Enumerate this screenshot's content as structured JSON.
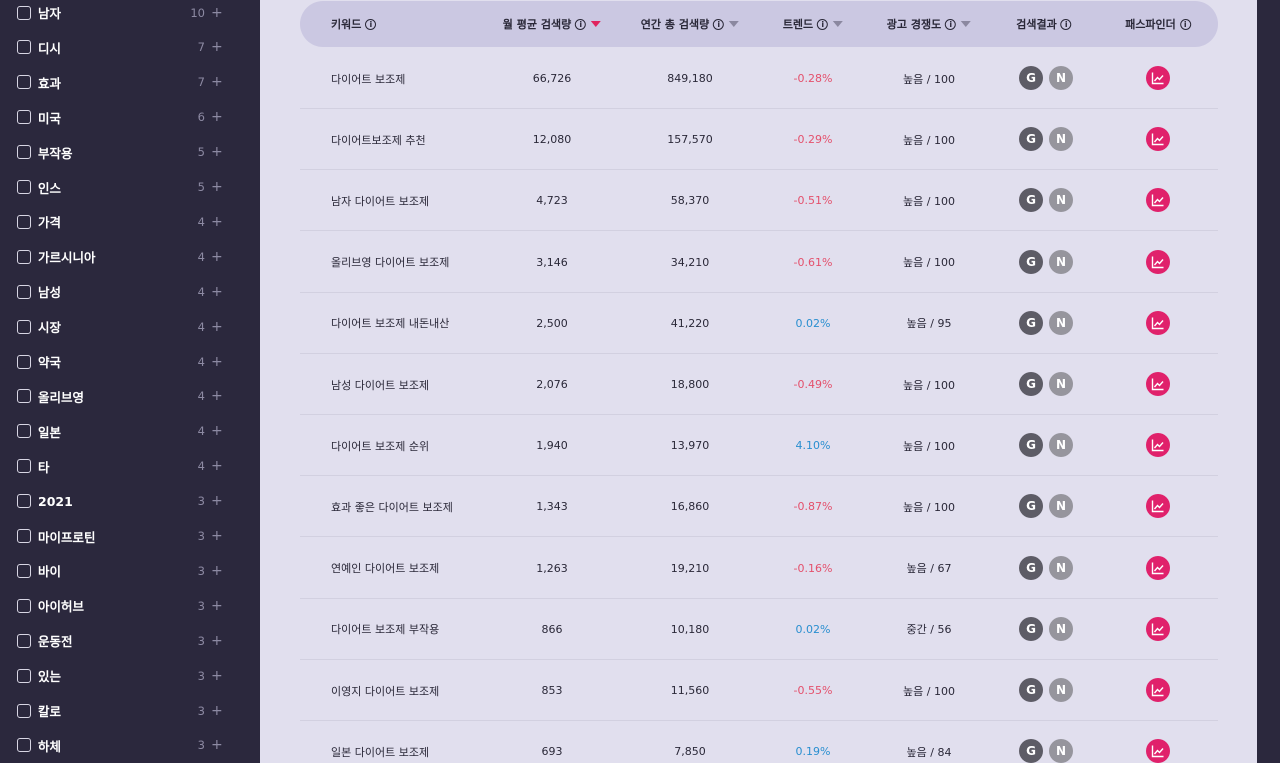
{
  "sidebar": {
    "items": [
      {
        "label": "남자",
        "count": "10"
      },
      {
        "label": "디시",
        "count": "7"
      },
      {
        "label": "효과",
        "count": "7"
      },
      {
        "label": "미국",
        "count": "6"
      },
      {
        "label": "부작용",
        "count": "5"
      },
      {
        "label": "인스",
        "count": "5"
      },
      {
        "label": "가격",
        "count": "4"
      },
      {
        "label": "가르시니아",
        "count": "4"
      },
      {
        "label": "남성",
        "count": "4"
      },
      {
        "label": "시장",
        "count": "4"
      },
      {
        "label": "약국",
        "count": "4"
      },
      {
        "label": "올리브영",
        "count": "4"
      },
      {
        "label": "일본",
        "count": "4"
      },
      {
        "label": "타",
        "count": "4"
      },
      {
        "label": "2021",
        "count": "3"
      },
      {
        "label": "마이프로틴",
        "count": "3"
      },
      {
        "label": "바이",
        "count": "3"
      },
      {
        "label": "아이허브",
        "count": "3"
      },
      {
        "label": "운동전",
        "count": "3"
      },
      {
        "label": "있는",
        "count": "3"
      },
      {
        "label": "칼로",
        "count": "3"
      },
      {
        "label": "하체",
        "count": "3"
      }
    ],
    "plus_symbol": "+"
  },
  "table": {
    "headers": {
      "keyword": "키워드",
      "monthly": "월 평균 검색량",
      "yearly": "연간 총 검색량",
      "trend": "트렌드",
      "competition": "광고 경쟁도",
      "results": "검색결과",
      "pathfinder": "패스파인더"
    },
    "info_symbol": "i",
    "google_label": "G",
    "naver_label": "N",
    "rows": [
      {
        "keyword": "다이어트 보조제",
        "monthly": "66,726",
        "yearly": "849,180",
        "trend": "-0.28%",
        "trend_dir": "neg",
        "competition": "높음 / 100"
      },
      {
        "keyword": "다이어트보조제 추천",
        "monthly": "12,080",
        "yearly": "157,570",
        "trend": "-0.29%",
        "trend_dir": "neg",
        "competition": "높음 / 100"
      },
      {
        "keyword": "남자 다이어트 보조제",
        "monthly": "4,723",
        "yearly": "58,370",
        "trend": "-0.51%",
        "trend_dir": "neg",
        "competition": "높음 / 100"
      },
      {
        "keyword": "올리브영 다이어트 보조제",
        "monthly": "3,146",
        "yearly": "34,210",
        "trend": "-0.61%",
        "trend_dir": "neg",
        "competition": "높음 / 100"
      },
      {
        "keyword": "다이어트 보조제 내돈내산",
        "monthly": "2,500",
        "yearly": "41,220",
        "trend": "0.02%",
        "trend_dir": "pos",
        "competition": "높음 / 95"
      },
      {
        "keyword": "남성 다이어트 보조제",
        "monthly": "2,076",
        "yearly": "18,800",
        "trend": "-0.49%",
        "trend_dir": "neg",
        "competition": "높음 / 100"
      },
      {
        "keyword": "다이어트 보조제 순위",
        "monthly": "1,940",
        "yearly": "13,970",
        "trend": "4.10%",
        "trend_dir": "pos",
        "competition": "높음 / 100"
      },
      {
        "keyword": "효과 좋은 다이어트 보조제",
        "monthly": "1,343",
        "yearly": "16,860",
        "trend": "-0.87%",
        "trend_dir": "neg",
        "competition": "높음 / 100"
      },
      {
        "keyword": "연예인 다이어트 보조제",
        "monthly": "1,263",
        "yearly": "19,210",
        "trend": "-0.16%",
        "trend_dir": "neg",
        "competition": "높음 / 67"
      },
      {
        "keyword": "다이어트 보조제 부작용",
        "monthly": "866",
        "yearly": "10,180",
        "trend": "0.02%",
        "trend_dir": "pos",
        "competition": "중간 / 56"
      },
      {
        "keyword": "이영지 다이어트 보조제",
        "monthly": "853",
        "yearly": "11,560",
        "trend": "-0.55%",
        "trend_dir": "neg",
        "competition": "높음 / 100"
      },
      {
        "keyword": "일본 다이어트 보조제",
        "monthly": "693",
        "yearly": "7,850",
        "trend": "0.19%",
        "trend_dir": "pos",
        "competition": "높음 / 84"
      }
    ]
  },
  "colors": {
    "sidebar_bg": "#2b283d",
    "main_bg": "#e1dfee",
    "header_bg": "#cbc8e2",
    "trend_negative": "#e4506c",
    "trend_positive": "#2a8fd0",
    "pathfinder_accent": "#e0216b",
    "sort_active": "#e0245e"
  },
  "icons": {
    "checkbox": "checkbox-icon",
    "plus": "plus-icon",
    "info": "info-icon",
    "sort": "sort-caret-icon",
    "google": "google-icon",
    "naver": "naver-icon",
    "pathfinder": "trend-chart-icon"
  }
}
